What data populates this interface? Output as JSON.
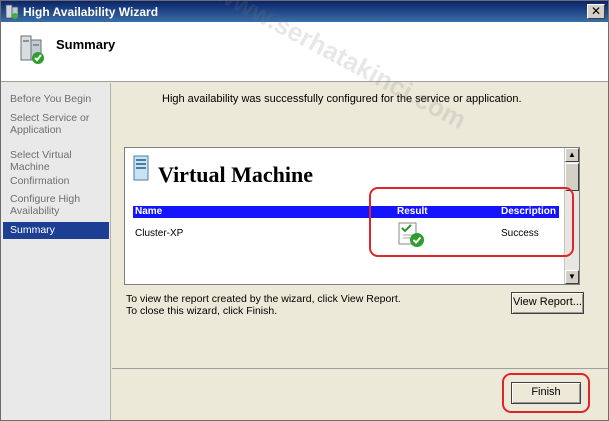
{
  "window": {
    "title": "High Availability Wizard",
    "close_glyph": "✕"
  },
  "header": {
    "title": "Summary"
  },
  "sidebar": {
    "items": [
      {
        "label": "Before You Begin"
      },
      {
        "label": "Select Service or Application"
      },
      {
        "label": "Select Virtual Machine"
      },
      {
        "label": "Confirmation"
      },
      {
        "label": "Configure High Availability"
      },
      {
        "label": "Summary",
        "active": true
      }
    ]
  },
  "main": {
    "success_message": "High availability was successfully configured for the service or application.",
    "report": {
      "title": "Virtual Machine",
      "columns": [
        "Name",
        "Result",
        "Description"
      ],
      "rows": [
        {
          "name": "Cluster-XP",
          "result_icon": "success-check-icon",
          "description": "Success"
        }
      ]
    },
    "instructions": {
      "line1": "To view the report created by the wizard, click View Report.",
      "line2": "To close this wizard, click Finish."
    },
    "view_report_label": "View Report...",
    "finish_label": "Finish"
  },
  "watermark": {
    "text": "www.serhatakinci.com"
  },
  "colors": {
    "table_header": "#1414ff",
    "active_nav": "#1c3f94",
    "annotation": "#e0242a",
    "title_bar": "#0a246a"
  }
}
